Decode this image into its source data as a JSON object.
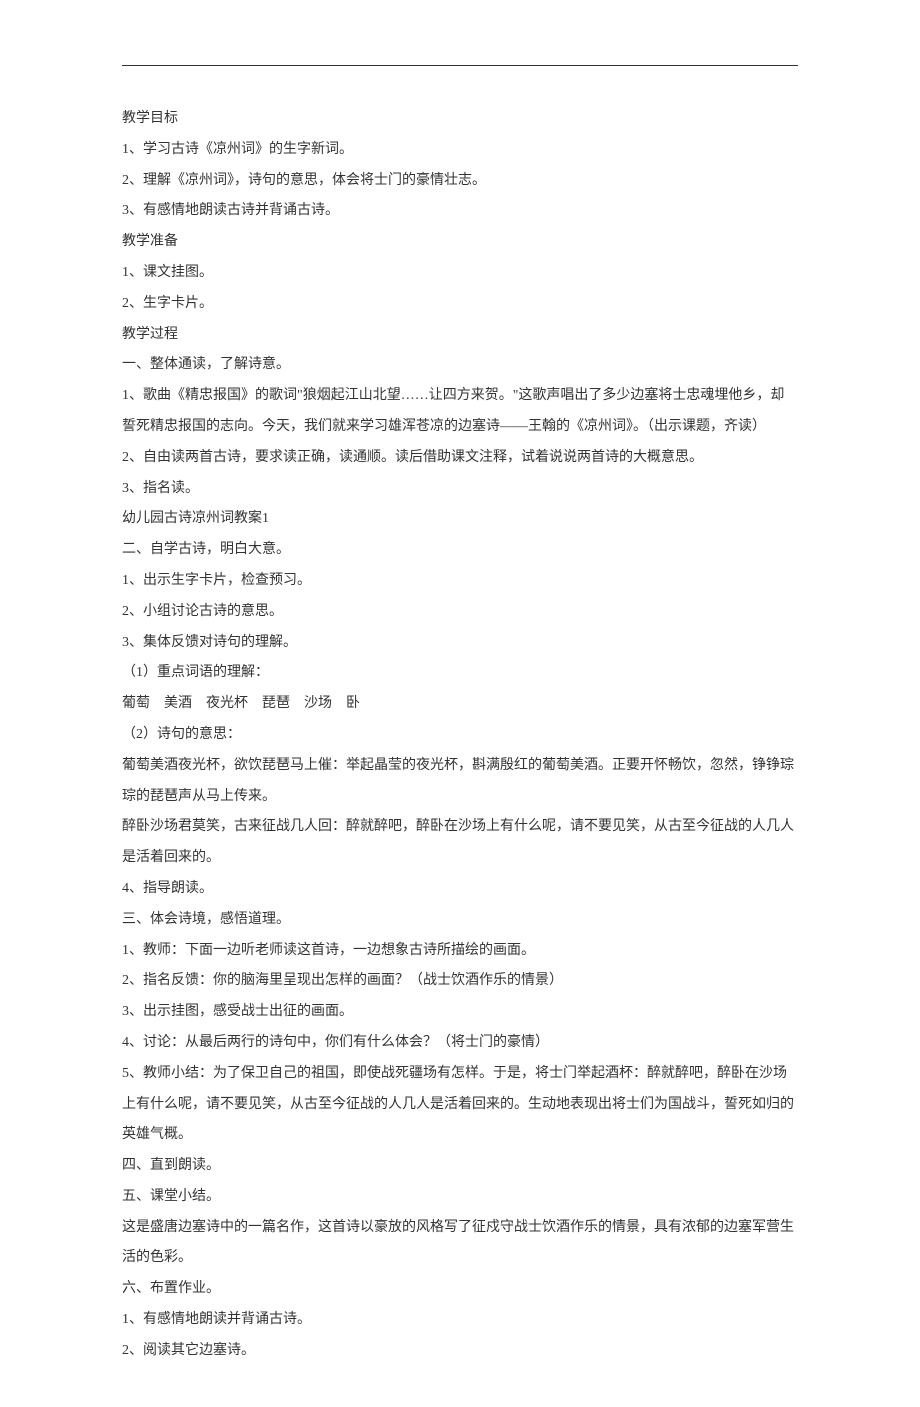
{
  "lines": [
    "教学目标",
    "1、学习古诗《凉州词》的生字新词。",
    "2、理解《凉州词》，诗句的意思，体会将士门的豪情壮志。",
    "3、有感情地朗读古诗并背诵古诗。",
    "教学准备",
    "1、课文挂图。",
    "2、生字卡片。",
    "教学过程",
    "一、整体通读，了解诗意。",
    "1、歌曲《精忠报国》的歌词\"狼烟起江山北望……让四方来贺。\"这歌声唱出了多少边塞将士忠魂埋他乡，却誓死精忠报国的志向。今天，我们就来学习雄浑苍凉的边塞诗——王翰的《凉州词》。（出示课题，齐读）",
    "2、自由读两首古诗，要求读正确，读通顺。读后借助课文注释，试着说说两首诗的大概意思。",
    "3、指名读。",
    "幼儿园古诗凉州词教案1",
    "二、自学古诗，明白大意。",
    "1、出示生字卡片，检查预习。",
    "2、小组讨论古诗的意思。",
    "3、集体反馈对诗句的理解。",
    "（1）重点词语的理解：",
    "葡萄　美酒　夜光杯　琵琶　沙场　卧",
    "（2）诗句的意思：",
    "葡萄美酒夜光杯，欲饮琵琶马上催：举起晶莹的夜光杯，斟满殷红的葡萄美酒。正要开怀畅饮，忽然，铮铮琮琮的琵琶声从马上传来。",
    "醉卧沙场君莫笑，古来征战几人回：醉就醉吧，醉卧在沙场上有什么呢，请不要见笑，从古至今征战的人几人是活着回来的。",
    "4、指导朗读。",
    "三、体会诗境，感悟道理。",
    "1、教师：下面一边听老师读这首诗，一边想象古诗所描绘的画面。",
    "2、指名反馈：你的脑海里呈现出怎样的画面？（战士饮酒作乐的情景）",
    "3、出示挂图，感受战士出征的画面。",
    "4、讨论：从最后两行的诗句中，你们有什么体会？（将士门的豪情）",
    "5、教师小结：为了保卫自己的祖国，即使战死疆场有怎样。于是，将士门举起酒杯：醉就醉吧，醉卧在沙场上有什么呢，请不要见笑，从古至今征战的人几人是活着回来的。生动地表现出将士们为国战斗，誓死如归的英雄气概。",
    "四、直到朗读。",
    "五、课堂小结。",
    "这是盛唐边塞诗中的一篇名作，这首诗以豪放的风格写了征戍守战士饮酒作乐的情景，具有浓郁的边塞军营生活的色彩。",
    "六、布置作业。",
    "1、有感情地朗读并背诵古诗。",
    "2、阅读其它边塞诗。"
  ]
}
